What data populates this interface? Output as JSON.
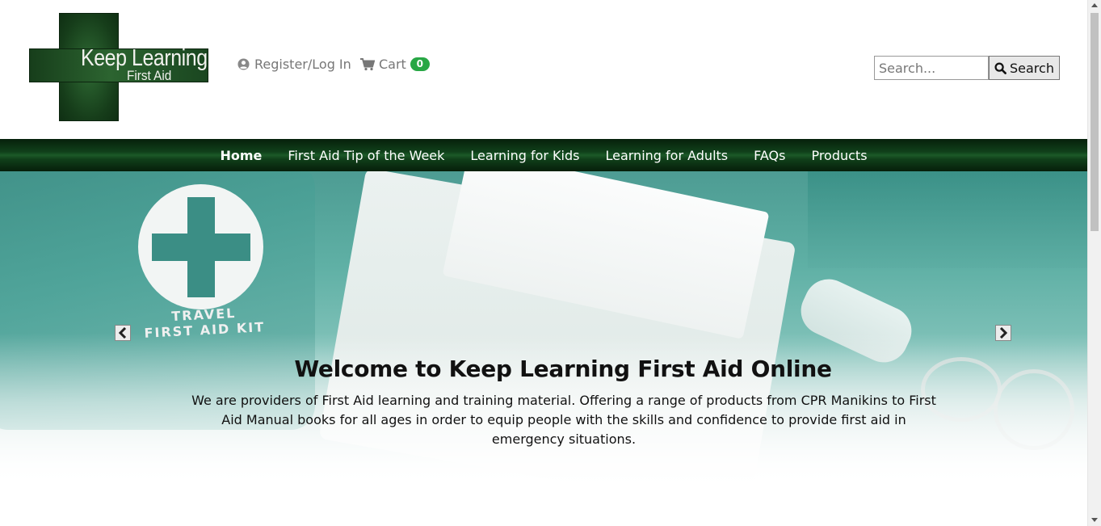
{
  "brand": {
    "logo_line1": "Keep Learning",
    "logo_line2": "First Aid"
  },
  "header": {
    "account_label": "Register/Log In",
    "cart_label": "Cart",
    "cart_count": "0",
    "search_placeholder": "Search...",
    "search_button_label": "Search"
  },
  "nav": {
    "items": [
      {
        "label": "Home",
        "active": true
      },
      {
        "label": "First Aid Tip of the Week"
      },
      {
        "label": "Learning for Kids"
      },
      {
        "label": "Learning for Adults"
      },
      {
        "label": "FAQs"
      },
      {
        "label": "Products"
      }
    ]
  },
  "hero": {
    "kit_text_line1": "TRAVEL",
    "kit_text_line2": "FIRST AID KIT",
    "title": "Welcome to Keep Learning First Aid Online",
    "text": "We are providers of First Aid learning and training material. Offering a range of products from CPR Manikins to First Aid Manual books for all ages in order to equip people with the skills and confidence to provide first aid in emergency situations."
  },
  "colors": {
    "nav_bg": "#10401a",
    "badge": "#28a745",
    "logo_green": "#1e4f22"
  }
}
